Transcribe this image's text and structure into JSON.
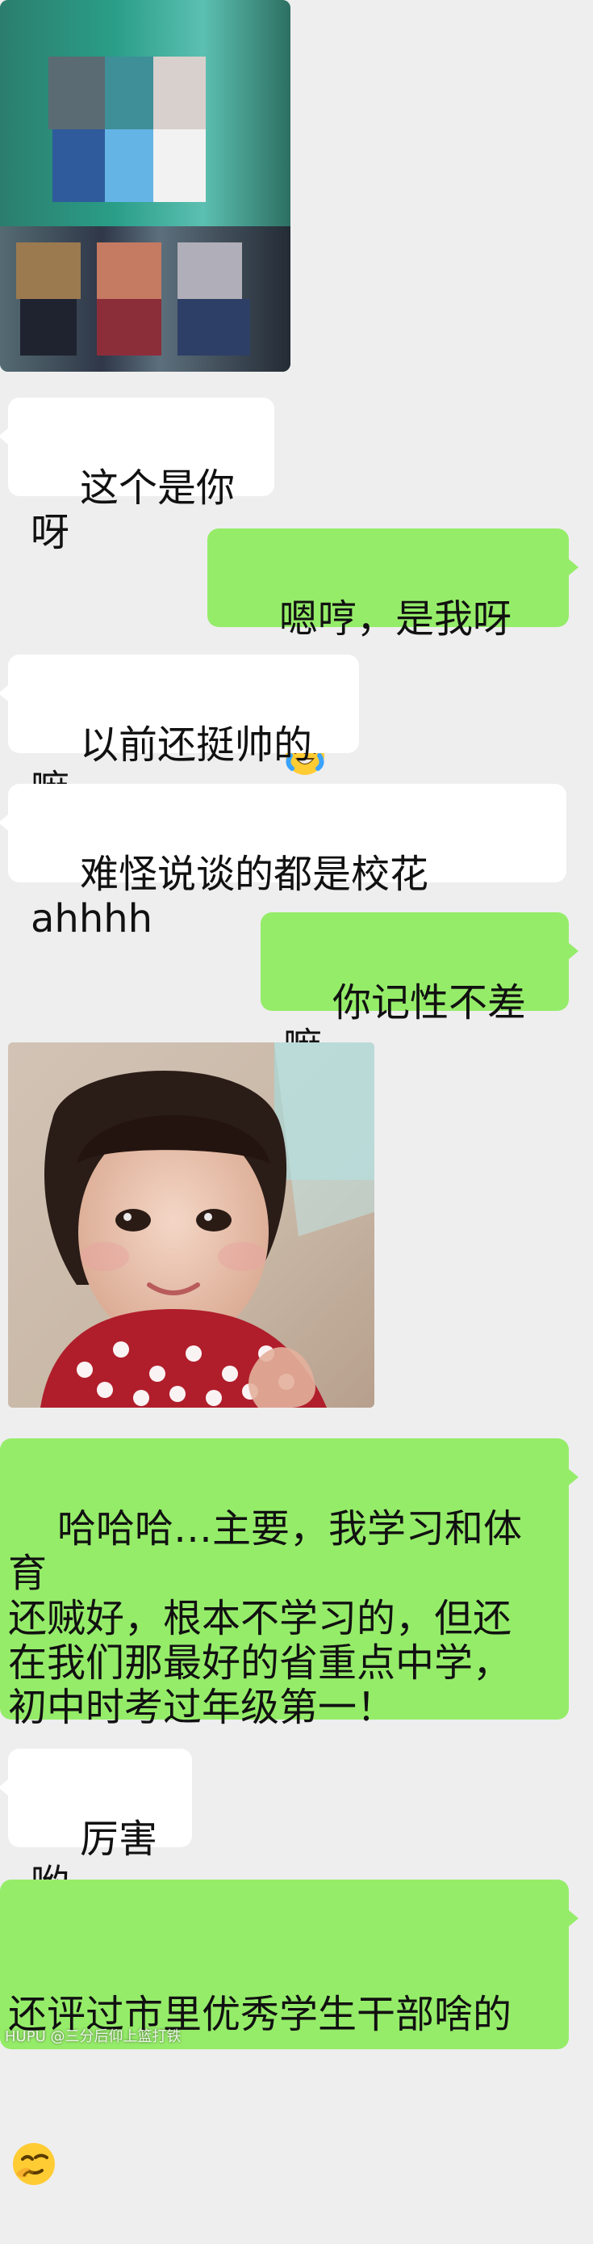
{
  "colors": {
    "background": "#eeeeee",
    "left_bubble": "#ffffff",
    "right_bubble": "#95ec69",
    "text": "#111111"
  },
  "images": {
    "top_photo": "pixelated group photo (censored)",
    "kid_photo": "little girl with bangs, red polka-dot sweater"
  },
  "messages": {
    "m1": "这个是你呀",
    "m2_text": "嗯哼，是我呀",
    "m2_emoji": "laughing-crying-emoji",
    "m3": "以前还挺帅的嘛",
    "m4": "难怪说谈的都是校花 ahhhh",
    "m5": "你记性不差嘛",
    "m6": "哈哈哈…主要，我学习和体育\n还贼好，根本不学习的，但还\n在我们那最好的省重点中学，\n初中时考过年级第一！",
    "m7": "厉害哟",
    "m8_text": "还评过市里优秀学生干部啥的",
    "m8_emoji": "thinking-emoji"
  },
  "watermark": "HUPU @三分后仰上篮打铁"
}
